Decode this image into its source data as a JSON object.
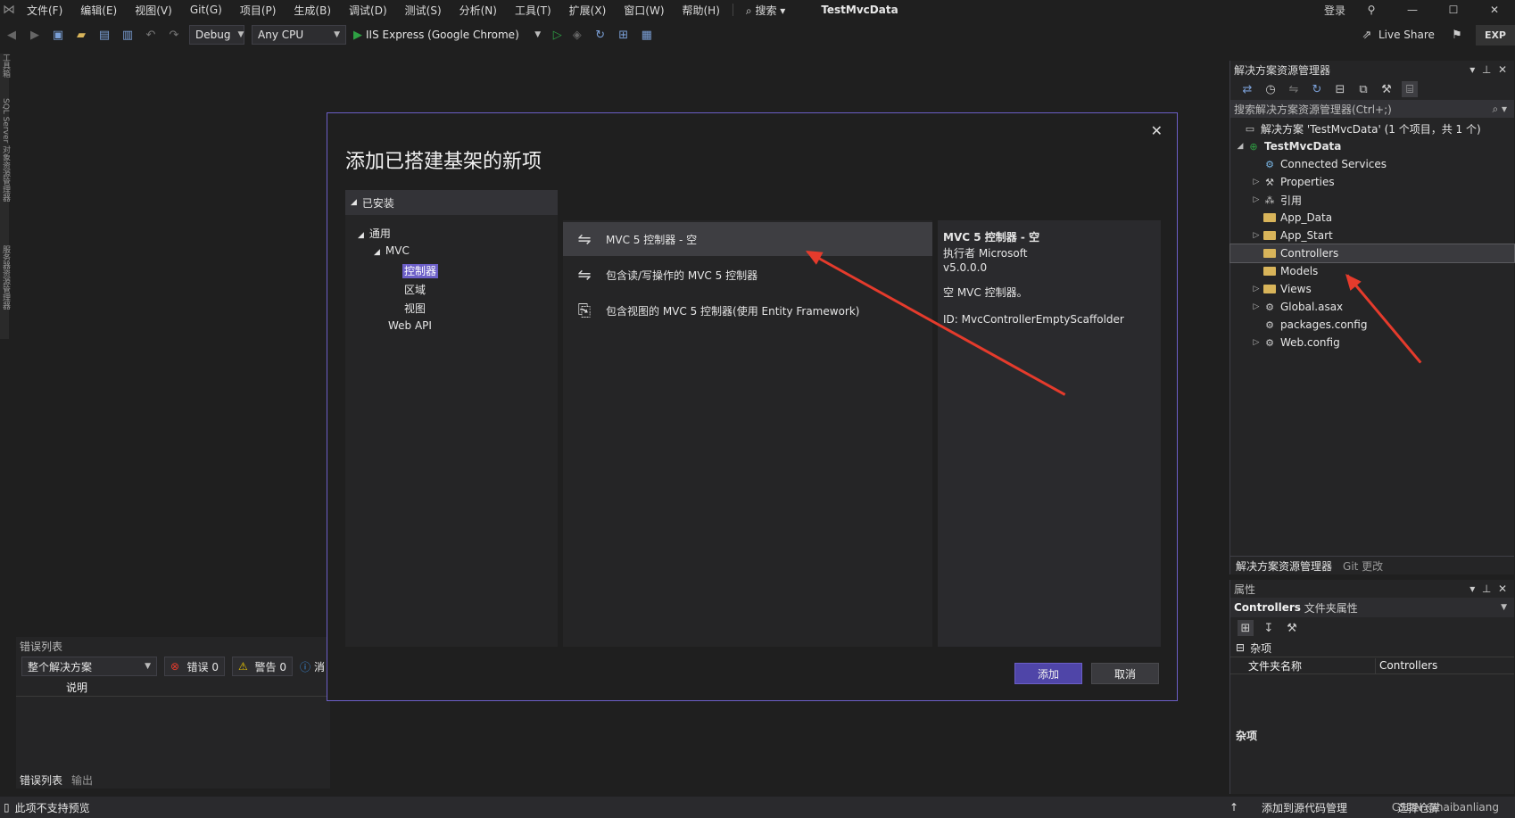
{
  "menu": {
    "items": [
      "文件(F)",
      "编辑(E)",
      "视图(V)",
      "Git(G)",
      "项目(P)",
      "生成(B)",
      "调试(D)",
      "测试(S)",
      "分析(N)",
      "工具(T)",
      "扩展(X)",
      "窗口(W)",
      "帮助(H)"
    ],
    "search": "搜索",
    "title": "TestMvcData",
    "login": "登录"
  },
  "toolbar": {
    "config": "Debug",
    "platform": "Any CPU",
    "run_target": "IIS Express (Google Chrome)",
    "live_share": "Live Share",
    "exp": "EXP"
  },
  "left_strip": [
    "工具箱",
    "SQL Server 对象资源管理器",
    "服务器资源管理器"
  ],
  "solution_explorer": {
    "title": "解决方案资源管理器",
    "search_placeholder": "搜索解决方案资源管理器(Ctrl+;)",
    "solution": "解决方案 'TestMvcData' (1 个项目，共 1 个)",
    "project": "TestMvcData",
    "items": [
      "Connected Services",
      "Properties",
      "引用",
      "App_Data",
      "App_Start",
      "Controllers",
      "Models",
      "Views",
      "Global.asax",
      "packages.config",
      "Web.config"
    ],
    "tabs": [
      "解决方案资源管理器",
      "Git 更改"
    ]
  },
  "properties": {
    "title": "属性",
    "object": "Controllers",
    "object_type": "文件夹属性",
    "category": "杂项",
    "prop_name": "文件夹名称",
    "prop_value": "Controllers",
    "desc_title": "杂项"
  },
  "error_list": {
    "title": "错误列表",
    "scope": "整个解决方案",
    "errors": "错误 0",
    "warnings": "警告 0",
    "messages": "消",
    "col_desc": "说明",
    "tabs": [
      "错误列表",
      "输出"
    ]
  },
  "dialog": {
    "title": "添加已搭建基架的新项",
    "installed": "已安装",
    "tree": {
      "general": "通用",
      "mvc": "MVC",
      "controller": "控制器",
      "area": "区域",
      "view": "视图",
      "webapi": "Web API"
    },
    "templates": [
      "MVC 5 控制器 - 空",
      "包含读/写操作的 MVC 5 控制器",
      "包含视图的 MVC 5 控制器(使用 Entity Framework)"
    ],
    "details": {
      "name": "MVC 5 控制器 - 空",
      "author": "执行者 Microsoft",
      "version": "v5.0.0.0",
      "desc": "空 MVC 控制器。",
      "id": "ID: MvcControllerEmptyScaffolder"
    },
    "add": "添加",
    "cancel": "取消"
  },
  "status": {
    "left": "此项不支持预览",
    "add_source": "添加到源代码管理",
    "repo": "选择仓库",
    "watermark": "CSDN @haibanliang"
  },
  "colors": {
    "accent": "#6c5fc7",
    "annotation_arrow": "#e53b2c"
  }
}
